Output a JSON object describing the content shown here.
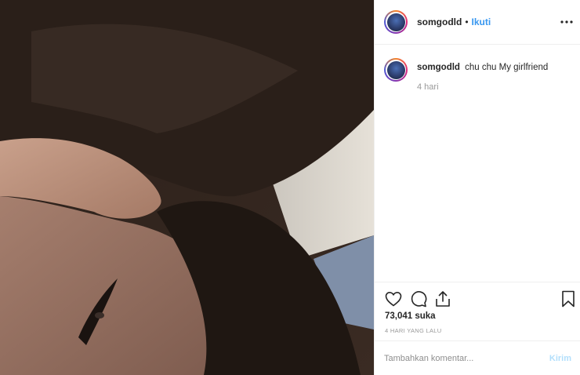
{
  "post": {
    "photo_label": "photo",
    "username": "somgodld",
    "separator": "•",
    "follow_label": "Ikuti"
  },
  "caption": {
    "username": "somgodld",
    "text": "chu chu My girlfriend",
    "time": "4 hari"
  },
  "stats": {
    "likes": "73,041 suka",
    "posted": "4 HARI YANG LALU"
  },
  "comment_box": {
    "placeholder": "Tambahkan komentar...",
    "post_label": "Kirim"
  },
  "icons": [
    "more-options-icon",
    "heart-icon",
    "comment-icon",
    "share-icon",
    "bookmark-icon"
  ],
  "colors": {
    "link_blue": "#3897f0",
    "post_disabled": "#b2dffc",
    "muted": "#999999"
  }
}
